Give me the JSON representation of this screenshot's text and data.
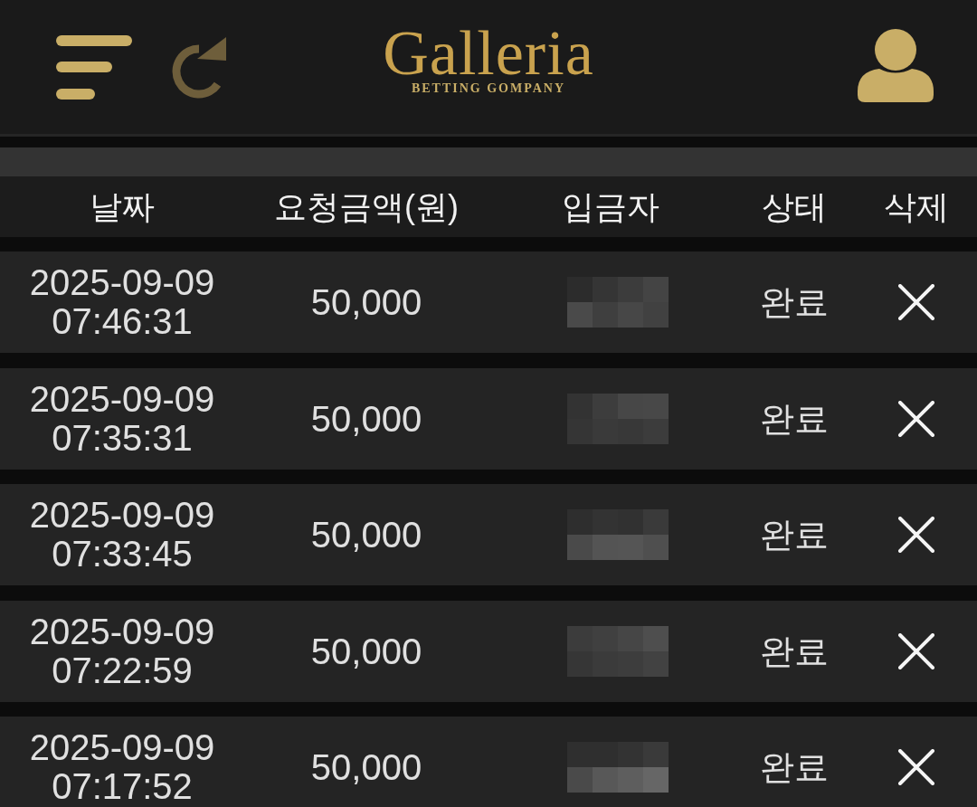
{
  "header": {
    "logo": "Galleria",
    "tagline": "BETTING GOMPANY"
  },
  "table": {
    "columns": [
      "날짜",
      "요청금액(원)",
      "입금자",
      "상태",
      "삭제"
    ],
    "rows": [
      {
        "date": "2025-09-09",
        "time": "07:46:31",
        "amount": "50,000",
        "depositor_redacted": true,
        "status": "완료"
      },
      {
        "date": "2025-09-09",
        "time": "07:35:31",
        "amount": "50,000",
        "depositor_redacted": true,
        "status": "완료"
      },
      {
        "date": "2025-09-09",
        "time": "07:33:45",
        "amount": "50,000",
        "depositor_redacted": true,
        "status": "완료"
      },
      {
        "date": "2025-09-09",
        "time": "07:22:59",
        "amount": "50,000",
        "depositor_redacted": true,
        "status": "완료"
      },
      {
        "date": "2025-09-09",
        "time": "07:17:52",
        "amount": "50,000",
        "depositor_redacted": true,
        "status": "완료"
      }
    ]
  }
}
